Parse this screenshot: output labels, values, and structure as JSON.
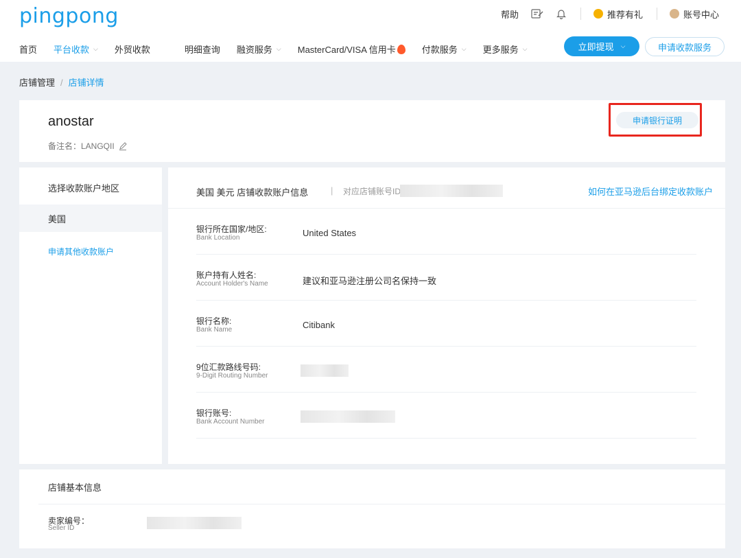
{
  "header": {
    "logo": "pingpong",
    "help": "帮助",
    "referral": "推荐有礼",
    "account_center": "账号中心",
    "colors": {
      "brand": "#1b9ee8",
      "highlight": "#e8261e"
    }
  },
  "nav": {
    "items": [
      {
        "label": "首页"
      },
      {
        "label": "平台收款"
      },
      {
        "label": "外贸收款"
      },
      {
        "label": "明细查询"
      },
      {
        "label": "融资服务"
      },
      {
        "label": "MasterCard/VISA 信用卡"
      },
      {
        "label": "付款服务"
      },
      {
        "label": "更多服务"
      }
    ],
    "withdraw_label": "立即提现",
    "apply_service_label": "申请收款服务"
  },
  "breadcrumb": {
    "parent": "店铺管理",
    "current": "店铺详情"
  },
  "store": {
    "name": "anostar",
    "remark": "备注名：LANGQII",
    "bank_proof_label": "申请银行证明"
  },
  "region": {
    "title": "选择收款账户地区",
    "selected": "美国",
    "apply_other": "申请其他收款账户"
  },
  "account": {
    "title": "美国 美元 店铺收款账户信息",
    "separator": "|",
    "store_account_label": "对应店铺账号ID",
    "help_link": "如何在亚马逊后台绑定收款账户",
    "fields": [
      {
        "label_cn": "银行所在国家/地区:",
        "label_en": "Bank Location",
        "value": "United States"
      },
      {
        "label_cn": "账户持有人姓名:",
        "label_en": "Account Holder's Name",
        "value": "建议和亚马逊注册公司名保持一致"
      },
      {
        "label_cn": "银行名称:",
        "label_en": "Bank Name",
        "value": "Citibank"
      },
      {
        "label_cn": "9位汇款路线号码:",
        "label_en": "9-Digit Routing Number",
        "value": ""
      },
      {
        "label_cn": "银行账号:",
        "label_en": "Bank Account Number",
        "value": ""
      }
    ]
  },
  "basic": {
    "title": "店铺基本信息",
    "seller_id_cn": "卖家编号：",
    "seller_id_en": "Seller ID"
  }
}
